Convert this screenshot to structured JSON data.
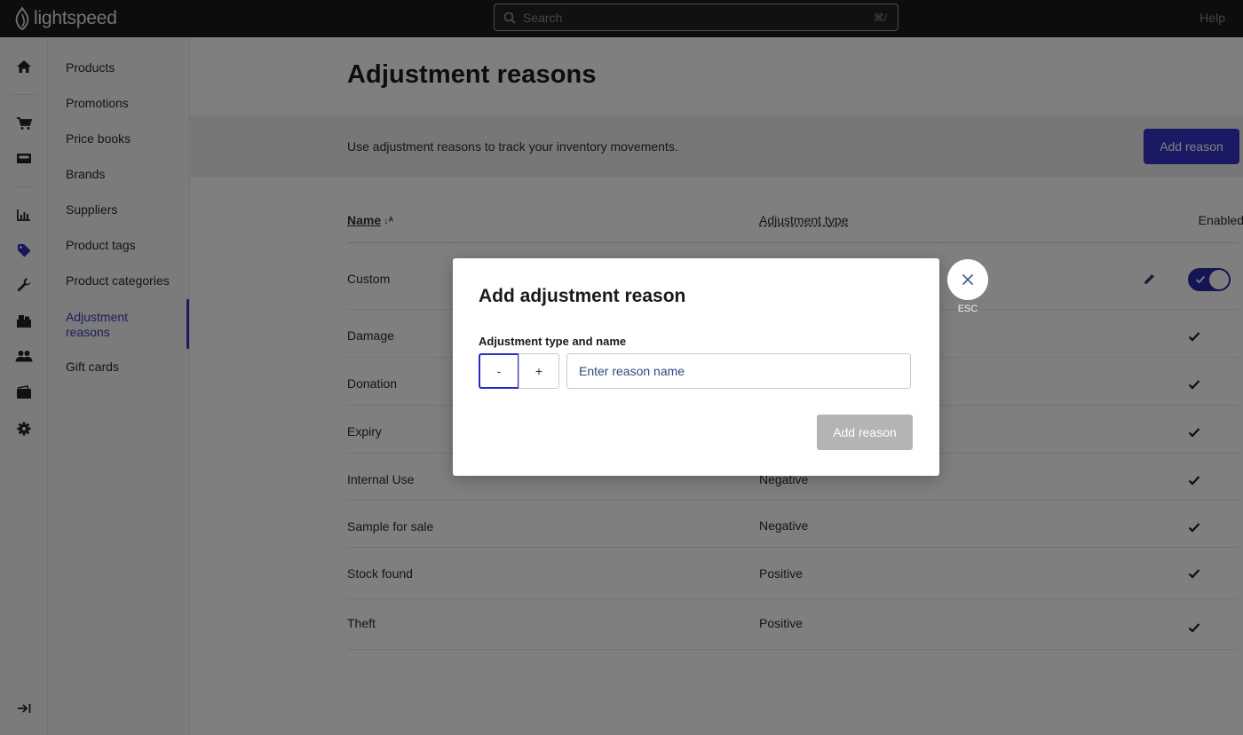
{
  "app": {
    "logo_text": "lightspeed",
    "search_placeholder": "Search",
    "search_shortcut": "⌘/",
    "help_label": "Help"
  },
  "rail": {
    "icons": [
      "home-icon",
      "cart-icon",
      "register-icon",
      "reports-icon",
      "tag-icon",
      "wrench-icon",
      "inventory-icon",
      "customers-icon",
      "wallet-icon",
      "settings-icon",
      "collapse-icon"
    ],
    "active": "tag-icon"
  },
  "submenu": {
    "items": [
      {
        "label": "Products"
      },
      {
        "label": "Promotions"
      },
      {
        "label": "Price books"
      },
      {
        "label": "Brands"
      },
      {
        "label": "Suppliers"
      },
      {
        "label": "Product tags"
      },
      {
        "label": "Product categories"
      },
      {
        "label": "Adjustment reasons",
        "active": true
      },
      {
        "label": "Gift cards"
      }
    ]
  },
  "page": {
    "title": "Adjustment reasons",
    "banner_text": "Use adjustment reasons to track your inventory movements.",
    "add_button": "Add reason",
    "columns": {
      "name": "Name",
      "type": "Adjustment type",
      "enabled": "Enabled"
    },
    "rows": [
      {
        "name": "Custom",
        "type": "",
        "enabled": true,
        "toggle": true
      },
      {
        "name": "Damage",
        "type": "",
        "enabled": true
      },
      {
        "name": "Donation",
        "type": "",
        "enabled": true
      },
      {
        "name": "Expiry",
        "type": "",
        "enabled": true
      },
      {
        "name": "Internal Use",
        "type": "Negative",
        "enabled": true
      },
      {
        "name": "Sample for sale",
        "type": "Negative",
        "enabled": true
      },
      {
        "name": "Stock found",
        "type": "Positive",
        "enabled": true
      },
      {
        "name": "Theft",
        "type": "Positive",
        "enabled": true
      }
    ]
  },
  "modal": {
    "title": "Add adjustment reason",
    "field_label": "Adjustment type and name",
    "minus_label": "-",
    "plus_label": "+",
    "input_placeholder": "Enter reason name",
    "input_value": "",
    "submit_label": "Add reason",
    "close_hint": "ESC"
  },
  "colors": {
    "accent": "#3434c9",
    "topbar": "#1b1b1b",
    "disabled_button": "#b4b4b4"
  }
}
